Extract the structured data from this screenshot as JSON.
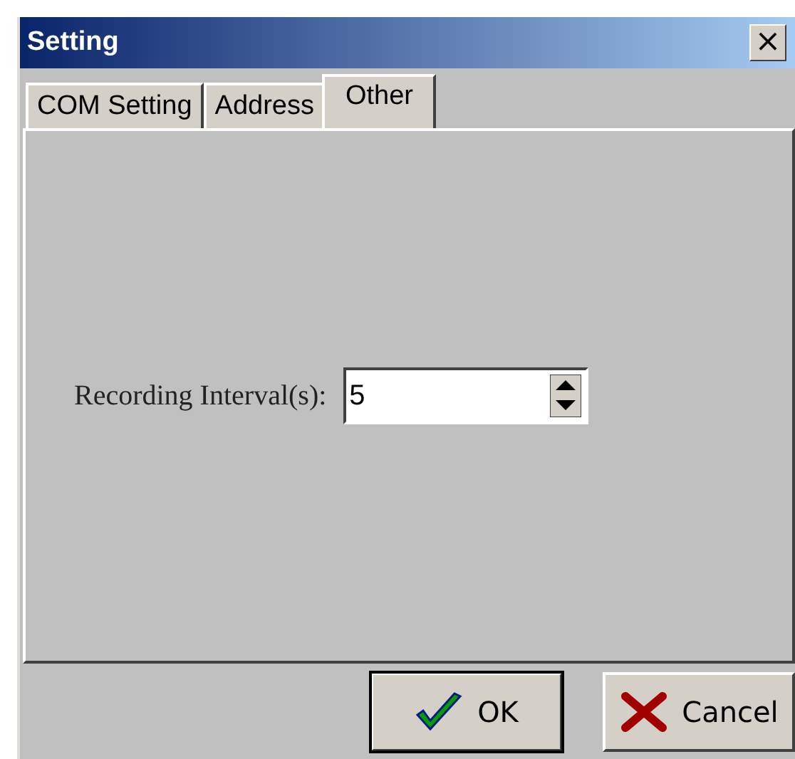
{
  "window": {
    "title": "Setting",
    "close": "×"
  },
  "tabs": [
    {
      "label": "COM Setting",
      "selected": false
    },
    {
      "label": "Address",
      "selected": false
    },
    {
      "label": "Other",
      "selected": true
    }
  ],
  "field": {
    "label": "Recording Interval(s):",
    "value": "5"
  },
  "buttons": [
    {
      "kind": "ok",
      "label": "OK",
      "default": true
    },
    {
      "kind": "cancel",
      "label": "Cancel",
      "default": false
    }
  ]
}
